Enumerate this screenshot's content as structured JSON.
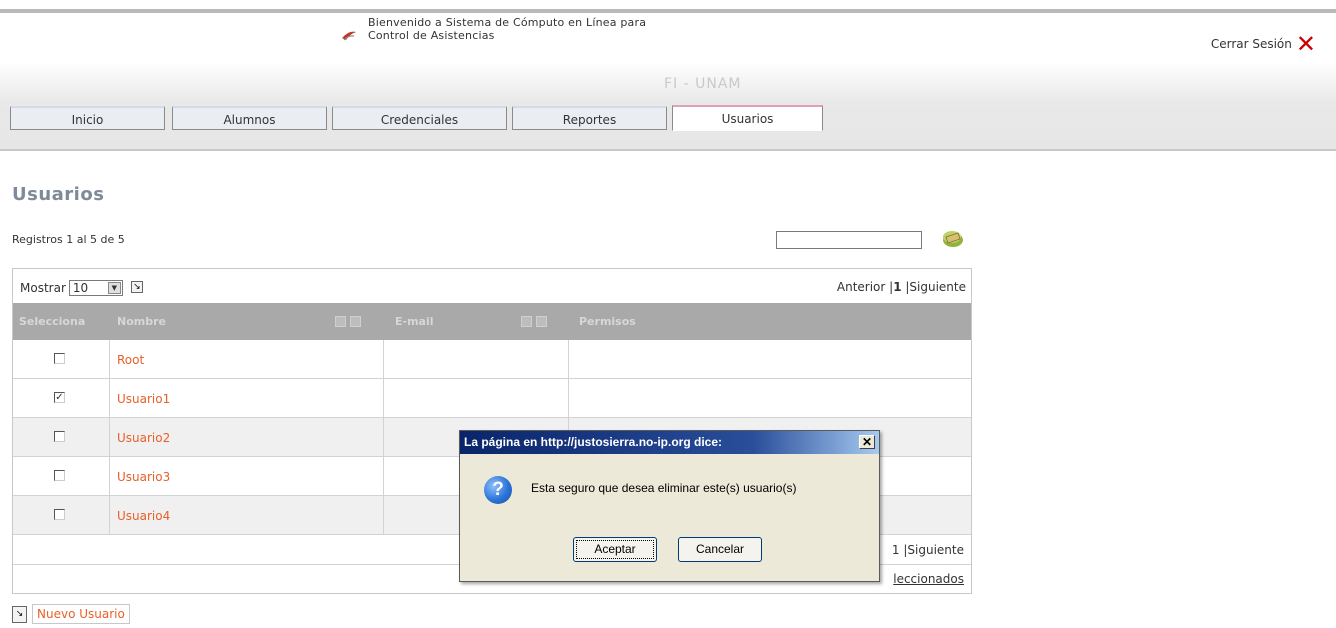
{
  "header": {
    "welcome_line1": "Bienvenido a Sistema de Cómputo en Línea para",
    "welcome_line2": "Control de Asistencias",
    "logout_label": "Cerrar Sesión",
    "banner_title": "FI - UNAM"
  },
  "nav": {
    "tabs": [
      {
        "label": "Inicio"
      },
      {
        "label": "Alumnos"
      },
      {
        "label": "Credenciales"
      },
      {
        "label": "Reportes"
      },
      {
        "label": "Usuarios",
        "active": true
      }
    ]
  },
  "page": {
    "title": "Usuarios",
    "records": "Registros 1 al 5 de 5",
    "search_value": ""
  },
  "grid": {
    "show_label": "Mostrar",
    "show_value": "10",
    "pager_prev": "Anterior",
    "pager_current": "1",
    "pager_next": "Siguiente",
    "columns": [
      "Selecciona",
      "Nombre",
      "E-mail",
      "Permisos"
    ],
    "rows": [
      {
        "checked": false,
        "name": "Root"
      },
      {
        "checked": true,
        "name": "Usuario1"
      },
      {
        "checked": false,
        "name": "Usuario2"
      },
      {
        "checked": false,
        "name": "Usuario3"
      },
      {
        "checked": false,
        "name": "Usuario4"
      }
    ],
    "pager_bottom_visible": "1 |Siguiente",
    "delete_visible": "leccionados"
  },
  "actions": {
    "new_user_label": "Nuevo Usuario"
  },
  "dialog": {
    "title": "La página en http://justosierra.no-ip.org dice:",
    "message": "Esta seguro que desea eliminar este(s) usuario(s)",
    "ok_label": "Aceptar",
    "cancel_label": "Cancelar",
    "icon": "question-icon"
  },
  "colors": {
    "link_orange": "#e8602a",
    "header_gray": "#a9a9a9",
    "title_blue_gray": "#7e8a99",
    "dialog_title_blue": "#0a246a"
  }
}
